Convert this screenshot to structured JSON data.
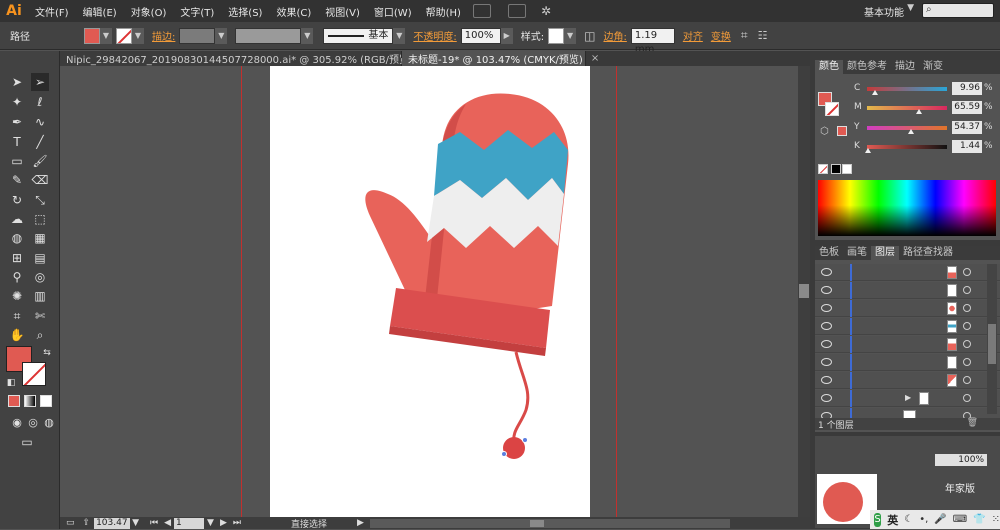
{
  "app": {
    "logo": "Ai"
  },
  "menu": [
    "文件(F)",
    "编辑(E)",
    "对象(O)",
    "文字(T)",
    "选择(S)",
    "效果(C)",
    "视图(V)",
    "窗口(W)",
    "帮助(H)"
  ],
  "workspace": {
    "label": "基本功能",
    "search_icon": "search-icon"
  },
  "control": {
    "object_type": "路径",
    "stroke_label": "描边:",
    "brush_label": "基本",
    "opacity_label": "不透明度:",
    "opacity_value": "100%",
    "style_label": "样式:",
    "corner_label": "边角:",
    "corner_value": "1.19 mm",
    "align_label": "对齐",
    "transform_label": "变换"
  },
  "tabs": [
    {
      "label": "Nipic_29842067_20190830144507728000.ai* @ 305.92% (RGB/预览)",
      "active": false
    },
    {
      "label": "未标题-19* @ 103.47% (CMYK/预览)",
      "active": true
    }
  ],
  "status": {
    "zoom": "103.47",
    "page": "1",
    "tool": "直接选择"
  },
  "color_panel": {
    "tabs": [
      "颜色",
      "颜色参考",
      "描边",
      "渐变"
    ],
    "channels": [
      {
        "label": "C",
        "value": "9.96",
        "unit": "%",
        "fraction": 0.1,
        "gradient": "#c43a3a,#2aa6d8"
      },
      {
        "label": "M",
        "value": "65.59",
        "unit": "%",
        "fraction": 0.656,
        "gradient": "#e3b84a,#d8285f"
      },
      {
        "label": "Y",
        "value": "54.37",
        "unit": "%",
        "fraction": 0.544,
        "gradient": "#d13ec2,#e0752a"
      },
      {
        "label": "K",
        "value": "1.44",
        "unit": "%",
        "fraction": 0.014,
        "gradient": "#e05a52,#111111"
      }
    ],
    "fill_color": "#e05a52"
  },
  "layers_panel": {
    "tabs": [
      "色板",
      "画笔",
      "图层",
      "路径查找器"
    ],
    "footer": "1 个图层"
  },
  "lower_panel": {
    "zoom": "100%",
    "footer_text": "年家版"
  },
  "artwork": {
    "mitten_main": "#e8635a",
    "mitten_shadow": "#d24d49",
    "zigzag_blue": "#3fa3c6",
    "zigzag_white": "#eeeeee",
    "cuff": "#db4e4e"
  },
  "tray": {
    "ime": "英"
  }
}
